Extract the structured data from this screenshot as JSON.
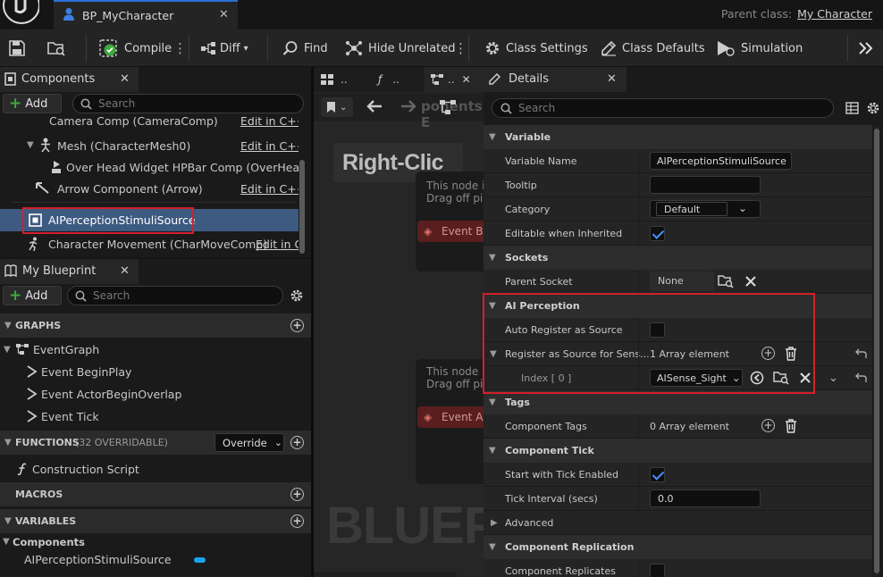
{
  "window": {
    "tab_title": "BP_MyCharacter",
    "parent_class_label": "Parent class:",
    "parent_class_value": "My Character"
  },
  "toolbar": {
    "compile": "Compile",
    "diff": "Diff",
    "find": "Find",
    "hide_unrelated": "Hide Unrelated",
    "class_settings": "Class Settings",
    "class_defaults": "Class Defaults",
    "simulation": "Simulation"
  },
  "components_panel": {
    "title": "Components",
    "add": "Add",
    "search_placeholder": "Search",
    "items": [
      {
        "label": "Camera Comp (CameraComp)",
        "edit": "Edit in C++"
      },
      {
        "label": "Mesh (CharacterMesh0)",
        "edit": "Edit in C++"
      },
      {
        "label": "Over Head Widget HPBar Comp (OverHeadWi",
        "edit": ""
      },
      {
        "label": "Arrow Component (Arrow)",
        "edit": "Edit in C++"
      },
      {
        "label": "AIPerceptionStimuliSource",
        "edit": ""
      },
      {
        "label": "Character Movement (CharMoveComp)",
        "edit": "Edit in C"
      }
    ]
  },
  "blueprint_panel": {
    "title": "My Blueprint",
    "add": "Add",
    "search_placeholder": "Search",
    "graphs_label": "GRAPHS",
    "event_graph": "EventGraph",
    "events": [
      "Event BeginPlay",
      "Event ActorBeginOverlap",
      "Event Tick"
    ],
    "functions_label": "FUNCTIONS",
    "functions_count": "(32 OVERRIDABLE)",
    "override": "Override",
    "construction_script": "Construction Script",
    "macros_label": "MACROS",
    "variables_label": "VARIABLES",
    "components_label": "Components",
    "variable_item": "AIPerceptionStimuliSource"
  },
  "graph": {
    "tabs": [
      "..",
      "..",
      ".."
    ],
    "breadcrumb": "ponents: E",
    "right_click_text": "Right-Clic",
    "node_hint_1": "This node i",
    "node_hint_2": "Drag off pi",
    "node_event_1": "Event B",
    "node_event_2": "Event A",
    "watermark": "BLUEP"
  },
  "details": {
    "title": "Details",
    "search_placeholder": "Search",
    "categories": {
      "variable": "Variable",
      "sockets": "Sockets",
      "ai_perception": "AI Perception",
      "tags": "Tags",
      "component_tick": "Component Tick",
      "advanced": "Advanced",
      "component_replication": "Component Replication"
    },
    "props": {
      "variable_name_label": "Variable Name",
      "variable_name_value": "AIPerceptionStimuliSource",
      "tooltip_label": "Tooltip",
      "tooltip_value": "",
      "category_label": "Category",
      "category_value": "Default",
      "editable_label": "Editable when Inherited",
      "parent_socket_label": "Parent Socket",
      "parent_socket_value": "None",
      "auto_register_label": "Auto Register as Source",
      "register_label": "Register as Source for Sens...",
      "register_value": "1 Array element",
      "index_label": "Index [ 0 ]",
      "index_value": "AISense_Sight",
      "component_tags_label": "Component Tags",
      "component_tags_value": "0 Array element",
      "start_tick_label": "Start with Tick Enabled",
      "tick_interval_label": "Tick Interval (secs)",
      "tick_interval_value": "0.0",
      "replicates_label": "Component Replicates"
    }
  },
  "colors": {
    "accent": "#2a6fd6",
    "highlight": "#d3202a",
    "selected_row": "#3d5a80",
    "check": "#4a90ff",
    "add_plus": "#3ea83e"
  }
}
